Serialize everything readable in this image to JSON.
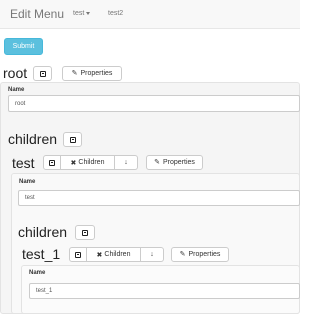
{
  "navbar": {
    "brand": "Edit Menu",
    "items": [
      {
        "label": "test"
      },
      {
        "label": "test2"
      }
    ]
  },
  "toolbar": {
    "submit_label": "Submit"
  },
  "root": {
    "title": "root",
    "properties_label": "Properties",
    "name_label": "Name",
    "name_value": "root"
  },
  "children_heading": "children",
  "test": {
    "title": "test",
    "children_btn_label": "Children",
    "properties_label": "Properties",
    "name_label": "Name",
    "name_value": "test"
  },
  "children_heading_2": "children",
  "test_1": {
    "title": "test_1",
    "children_btn_label": "Children",
    "properties_label": "Properties",
    "name_label": "Name",
    "name_value": "test_1"
  },
  "icons": {
    "collapse": "collapse-icon",
    "close": "times-icon",
    "down": "arrow-down-icon",
    "pencil": "pencil-icon"
  },
  "colors": {
    "primary": "#5bc0de",
    "navbar_bg": "#f8f8f8",
    "panel_bg": "#f5f5f5"
  }
}
